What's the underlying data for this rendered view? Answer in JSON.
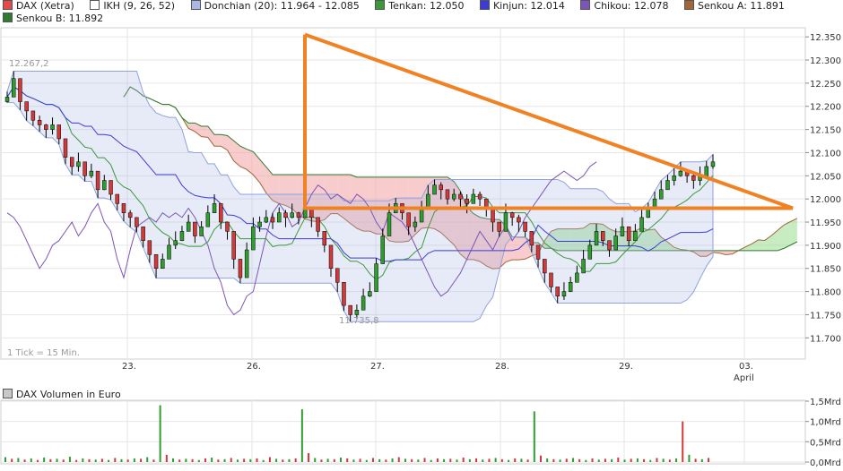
{
  "legend": {
    "items": [
      {
        "label": "DAX (Xetra)",
        "color": "#e34a4a"
      },
      {
        "label": "IKH (9, 26, 52)",
        "color": "#ffffff"
      },
      {
        "label": "Donchian (20): 11.964 - 12.085",
        "color": "#a9b8e4"
      },
      {
        "label": "Tenkan: 12.050",
        "color": "#3a9a3a"
      },
      {
        "label": "Kinjun: 12.014",
        "color": "#3b3bd8"
      },
      {
        "label": "Chikou: 12.078",
        "color": "#7b55b8"
      },
      {
        "label": "Senkou A: 11.891",
        "color": "#a0663a"
      },
      {
        "label": "Senkou B: 11.892",
        "color": "#2f7a2f"
      }
    ]
  },
  "chart_data": [
    {
      "type": "candlestick",
      "title": "DAX (Xetra)",
      "x_ticks": [
        "23.",
        "26.",
        "27.",
        "28.",
        "29.",
        "03."
      ],
      "x_sublabel": "April",
      "y_ticks": [
        "12.350",
        "12.300",
        "12.250",
        "12.200",
        "12.150",
        "12.100",
        "12.050",
        "12.000",
        "11.950",
        "11.900",
        "11.850",
        "11.800",
        "11.750",
        "11.700"
      ],
      "ylim": [
        11.66,
        12.36
      ],
      "grid": true,
      "annotations": {
        "high_label": "12.267,2",
        "low_label": "11.735,8",
        "tick_note": "1 Tick = 15 Min."
      },
      "closes": [
        12.22,
        12.26,
        12.21,
        12.19,
        12.17,
        12.16,
        12.15,
        12.16,
        12.13,
        12.09,
        12.07,
        12.08,
        12.05,
        12.06,
        12.02,
        12.04,
        12.01,
        11.99,
        11.97,
        11.96,
        11.94,
        11.91,
        11.88,
        11.85,
        11.87,
        11.9,
        11.91,
        11.93,
        11.95,
        11.92,
        11.94,
        11.97,
        11.99,
        11.95,
        11.93,
        11.87,
        11.83,
        11.89,
        11.94,
        11.95,
        11.96,
        11.95,
        11.97,
        11.96,
        11.97,
        11.96,
        11.98,
        11.96,
        11.93,
        11.9,
        11.85,
        11.82,
        11.77,
        11.75,
        11.76,
        11.79,
        11.8,
        11.86,
        11.92,
        11.97,
        11.99,
        11.97,
        11.94,
        11.95,
        11.98,
        12.01,
        12.03,
        12.02,
        12.0,
        12.01,
        12.0,
        11.99,
        12.01,
        12.0,
        11.98,
        11.95,
        11.93,
        11.97,
        11.96,
        11.95,
        11.93,
        11.9,
        11.87,
        11.84,
        11.81,
        11.79,
        11.8,
        11.82,
        11.84,
        11.87,
        11.9,
        11.93,
        11.91,
        11.89,
        11.92,
        11.94,
        11.91,
        11.93,
        11.96,
        11.98,
        12.0,
        12.02,
        12.04,
        12.05,
        12.06,
        12.05,
        12.04,
        12.05,
        12.07,
        12.08
      ],
      "series": {
        "tenkan_end": 12.05,
        "kinjun_end": 12.014,
        "chikou_end": 12.078,
        "senkou_a_end": 11.891,
        "senkou_b_end": 11.892
      },
      "drawing": {
        "type": "triangle",
        "color": "#f08224",
        "apex_price": 12.355,
        "base_price": 11.98
      }
    },
    {
      "type": "bar",
      "title": "DAX Volumen in Euro",
      "y_ticks": [
        "1,5Mrd",
        "1,0Mrd",
        "0,5Mrd",
        "0,0Mrd"
      ],
      "ylim": [
        0,
        1.5
      ],
      "unit": "Mrd",
      "values": [
        0.12,
        0.08,
        0.1,
        0.06,
        0.09,
        0.05,
        0.11,
        0.07,
        0.08,
        0.06,
        0.13,
        0.05,
        0.09,
        0.07,
        0.06,
        0.08,
        0.05,
        0.1,
        0.07,
        0.06,
        0.09,
        0.08,
        0.12,
        0.06,
        1.4,
        0.18,
        0.09,
        0.06,
        0.08,
        0.07,
        0.05,
        0.09,
        0.11,
        0.06,
        0.07,
        0.1,
        0.06,
        0.08,
        0.07,
        0.09,
        0.05,
        0.12,
        0.08,
        0.06,
        0.07,
        0.09,
        1.3,
        0.22,
        0.1,
        0.06,
        0.08,
        0.07,
        0.11,
        0.09,
        0.06,
        0.08,
        0.05,
        0.1,
        0.07,
        0.06,
        0.09,
        0.12,
        0.08,
        0.07,
        0.06,
        0.1,
        0.05,
        0.09,
        0.07,
        0.08,
        0.06,
        0.11,
        0.07,
        0.09,
        0.06,
        0.08,
        0.1,
        0.07,
        0.05,
        0.09,
        0.08,
        0.06,
        1.25,
        0.16,
        0.09,
        0.07,
        0.06,
        0.08,
        0.1,
        0.07,
        0.05,
        0.09,
        0.06,
        0.08,
        0.07,
        0.11,
        0.06,
        0.08,
        0.09,
        0.07,
        0.05,
        0.1,
        0.08,
        0.06,
        0.09,
        1.0,
        0.18,
        0.08,
        0.07,
        0.1
      ]
    }
  ],
  "vol_legend": {
    "label": "DAX Volumen in Euro"
  }
}
